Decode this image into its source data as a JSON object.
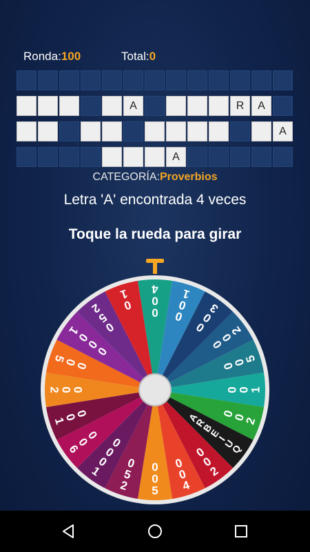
{
  "stats": {
    "round_label": "Ronda:",
    "round_value": "100",
    "total_label": "Total:",
    "total_value": "0"
  },
  "board": {
    "rows": [
      [
        "",
        "",
        "",
        "",
        "",
        "",
        "",
        "",
        "",
        "",
        "",
        "",
        ""
      ],
      [
        " ",
        " ",
        " ",
        "",
        " ",
        "A",
        "",
        " ",
        " ",
        " ",
        "R",
        "A",
        ""
      ],
      [
        " ",
        " ",
        "",
        " ",
        " ",
        "",
        " ",
        " ",
        " ",
        " ",
        "",
        " ",
        "A"
      ],
      [
        "",
        "",
        "",
        "",
        " ",
        " ",
        " ",
        "A",
        "",
        "",
        "",
        "",
        ""
      ]
    ]
  },
  "category": {
    "label": "CATEGORÍA:",
    "value": "Proverbios"
  },
  "message": "Letra 'A' encontrada 4 veces",
  "instruction": "Toque la rueda para girar",
  "wheel": {
    "segments": [
      {
        "label": "400",
        "color": "#16a085"
      },
      {
        "label": "100",
        "color": "#2e86c1"
      },
      {
        "label": "300",
        "color": "#1a3f73"
      },
      {
        "label": "200",
        "color": "#1f5c8a"
      },
      {
        "label": "500",
        "color": "#1e7b8c"
      },
      {
        "label": "100",
        "color": "#16a89a"
      },
      {
        "label": "200",
        "color": "#27a33a"
      },
      {
        "label": "QUIEBRA",
        "color": "#1a1a1a"
      },
      {
        "label": "200",
        "color": "#c0152b"
      },
      {
        "label": "400",
        "color": "#e8432a"
      },
      {
        "label": "500",
        "color": "#f08a1c"
      },
      {
        "label": "250",
        "color": "#8e1c55"
      },
      {
        "label": "1000",
        "color": "#6a1a60"
      },
      {
        "label": "600",
        "color": "#b0105a"
      },
      {
        "label": "100",
        "color": "#7a1240"
      },
      {
        "label": "200",
        "color": "#f0871e"
      },
      {
        "label": "500",
        "color": "#f26a1b"
      },
      {
        "label": "1000",
        "color": "#8a2a9a"
      },
      {
        "label": "250",
        "color": "#6e2b8a"
      },
      {
        "label": "10",
        "color": "#d6232a"
      }
    ],
    "rim_color": "#e9e9e9",
    "hub_color": "#e6e6e6",
    "pointer_color": "#f5a623"
  },
  "navbar": {
    "back_icon": "back-triangle-icon",
    "home_icon": "home-circle-icon",
    "recents_icon": "recents-square-icon"
  }
}
